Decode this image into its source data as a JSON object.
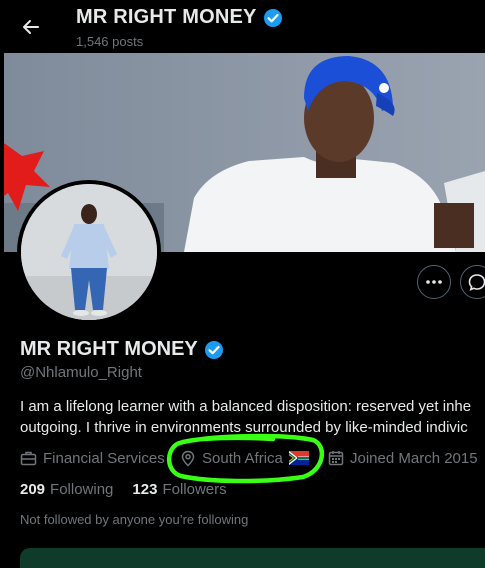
{
  "header": {
    "name": "MR RIGHT MONEY",
    "posts": "1,546 posts"
  },
  "profile": {
    "name": "MR RIGHT MONEY",
    "handle": "@Nhlamulo_Right",
    "bio_line1": "I am a lifelong learner with a balanced disposition: reserved yet inhe",
    "bio_line2": "outgoing. I thrive in environments surrounded by like-minded indivic",
    "category": "Financial Services",
    "location": "South Africa",
    "joined": "Joined March 2015",
    "following_count": "209",
    "following_label": "Following",
    "followers_count": "123",
    "followers_label": "Followers",
    "not_followed": "Not followed by anyone you’re following"
  },
  "icons": {
    "back": "back-arrow-icon",
    "verified": "verified-badge-icon",
    "more": "more-dots-icon",
    "message": "message-icon",
    "category": "briefcase-icon",
    "location": "location-pin-icon",
    "calendar": "calendar-icon",
    "flag": "south-africa-flag-icon"
  },
  "colors": {
    "verified": "#1d9bf0",
    "highlight": "#39ff14",
    "muted": "#71767b"
  }
}
